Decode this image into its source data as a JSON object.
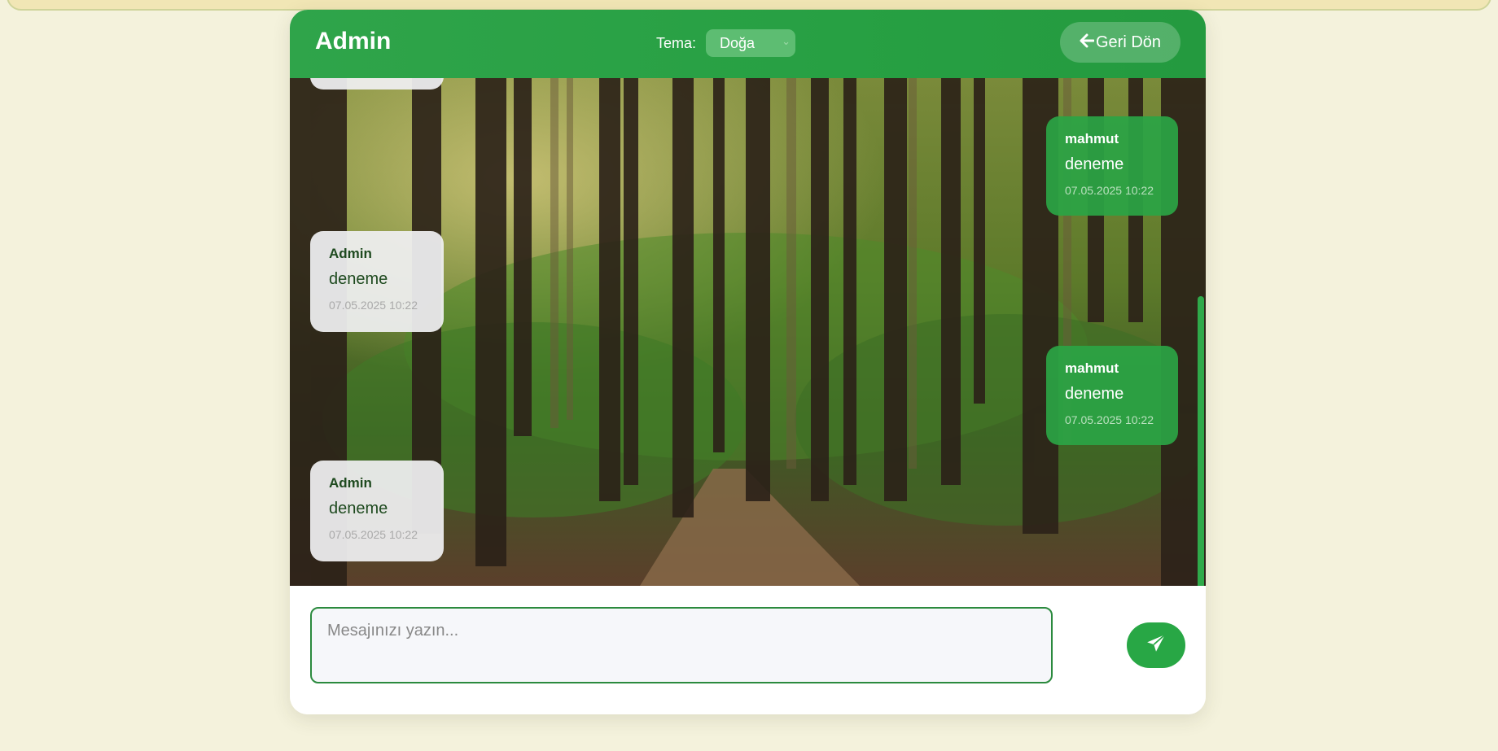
{
  "header": {
    "title": "Admin",
    "theme_label": "Tema:",
    "theme_selected": "Doğa",
    "back_label": "Geri Dön"
  },
  "messages": [
    {
      "author": "mahmut",
      "text": "deneme",
      "time": "07.05.2025 10:22",
      "direction": "outgoing"
    },
    {
      "author": "Admin",
      "text": "deneme",
      "time": "07.05.2025 10:22",
      "direction": "incoming"
    },
    {
      "author": "mahmut",
      "text": "deneme",
      "time": "07.05.2025 10:22",
      "direction": "outgoing"
    },
    {
      "author": "Admin",
      "text": "deneme",
      "time": "07.05.2025 10:22",
      "direction": "incoming"
    }
  ],
  "composer": {
    "placeholder": "Mesajınızı yazın...",
    "value": ""
  },
  "icons": {
    "back": "arrow-left-icon",
    "send": "paper-plane-icon",
    "select": "chevron-down-icon"
  },
  "colors": {
    "accent": "#28a745",
    "background": "#f4f2dc",
    "incoming_bubble": "#f0f0f2",
    "outgoing_bubble": "#2ba445"
  }
}
